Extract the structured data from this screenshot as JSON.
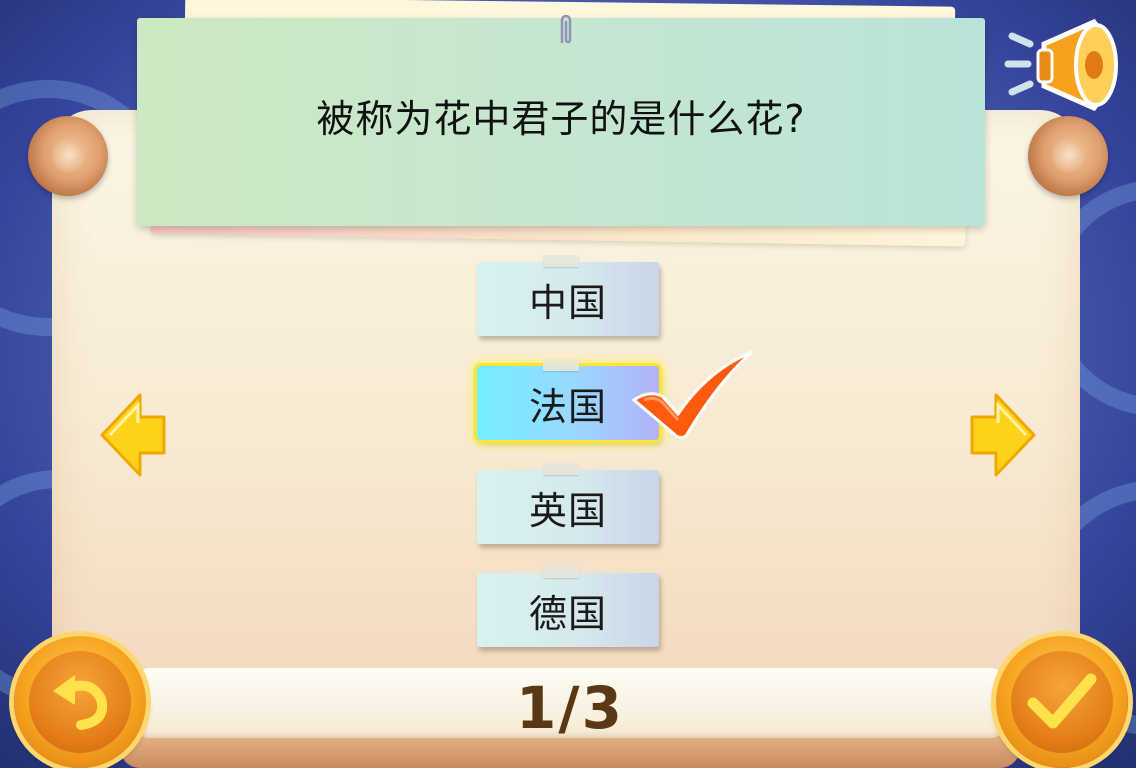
{
  "question": {
    "text": "被称为花中君子的是什么花?"
  },
  "options": [
    {
      "label": "中国",
      "selected": false
    },
    {
      "label": "法国",
      "selected": true
    },
    {
      "label": "英国",
      "selected": false
    },
    {
      "label": "德国",
      "selected": false
    }
  ],
  "progress": {
    "text": "1/3",
    "current": 1,
    "total": 3
  },
  "icons": {
    "speaker": "speaker-icon",
    "back": "undo-arrow-icon",
    "confirm": "checkmark-icon",
    "prev": "left-arrow-icon",
    "next": "right-arrow-icon",
    "selected_mark": "red-checkmark-icon"
  },
  "colors": {
    "background": "#4f66b8",
    "card": "#c6e6cf",
    "selected_tile": "#71f0ff",
    "selected_glow": "#ffe433",
    "button_orange": "#f6a21f",
    "arrow_yellow": "#ffd21a",
    "progress_text": "#5a3815"
  }
}
